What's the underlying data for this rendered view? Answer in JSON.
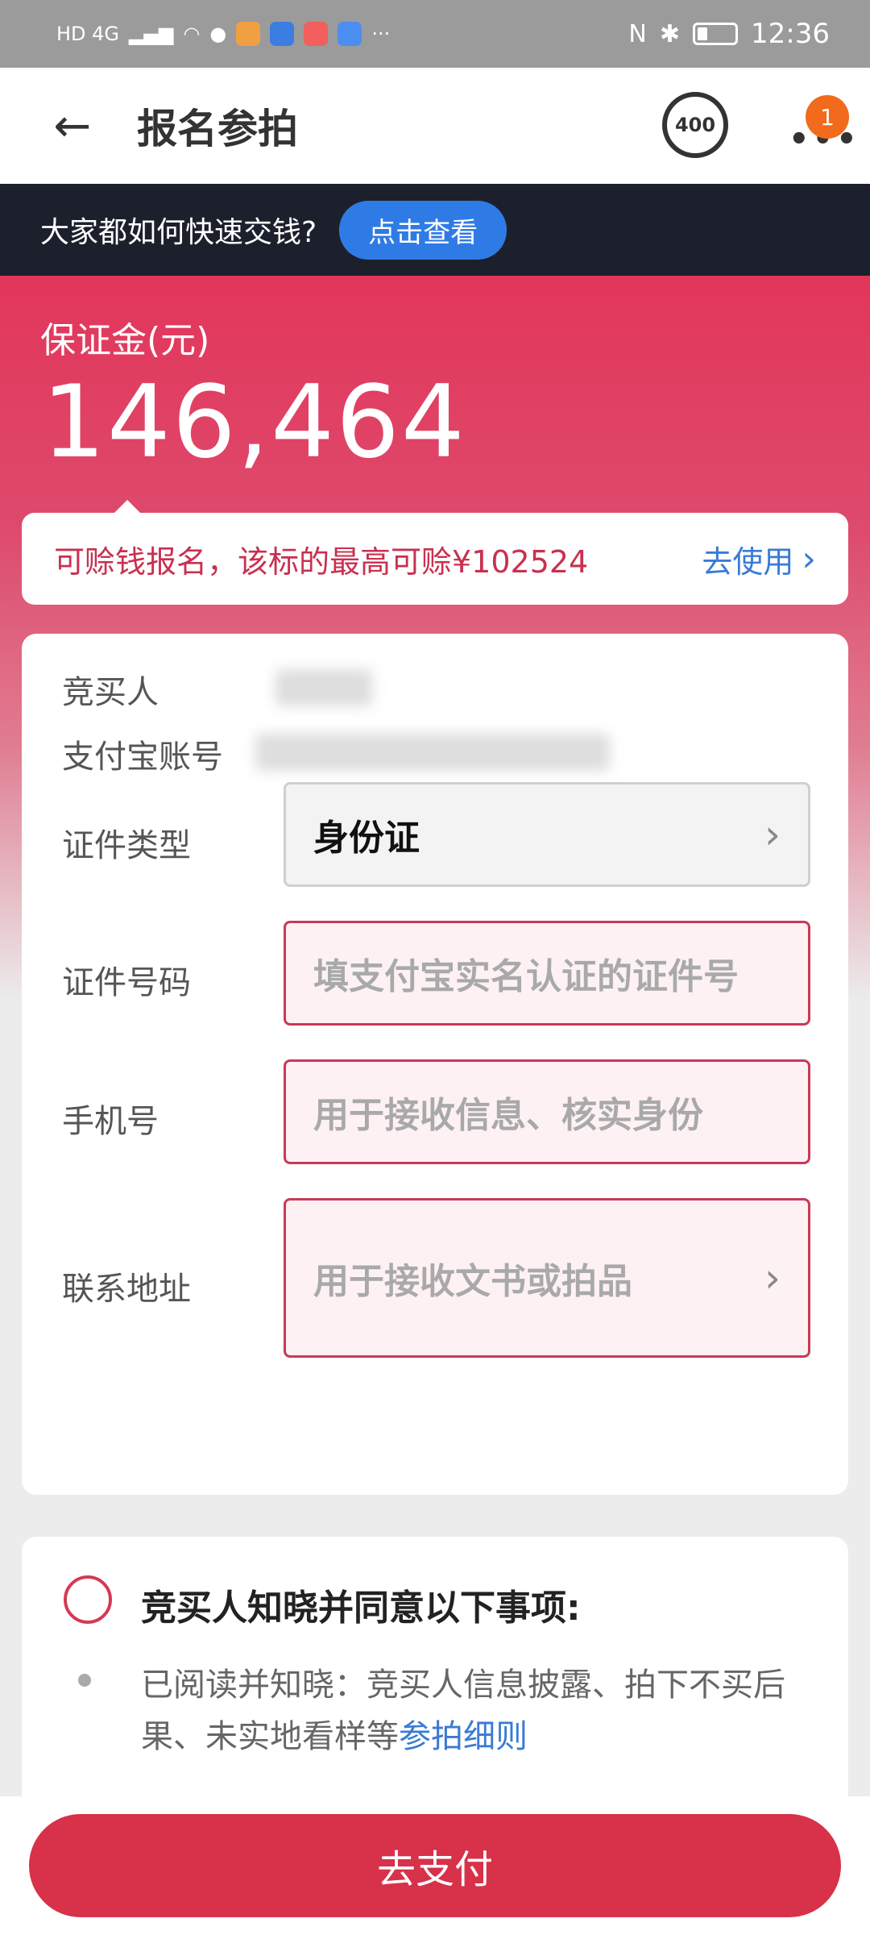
{
  "status_bar": {
    "left_text": "HD 4G",
    "time": "12:36"
  },
  "nav": {
    "title": "报名参拍",
    "hotline_label": "400",
    "badge_count": "1"
  },
  "banner": {
    "text": "大家都如何快速交钱?",
    "button": "点击查看"
  },
  "deposit": {
    "label": "保证金(元)",
    "amount": "146,464"
  },
  "coupon": {
    "text": "可赊钱报名，该标的最高可赊¥102524",
    "action": "去使用"
  },
  "form": {
    "bidder_label": "竞买人",
    "alipay_label": "支付宝账号",
    "id_type_label": "证件类型",
    "id_type_value": "身份证",
    "id_number_label": "证件号码",
    "id_number_placeholder": "填支付宝实名认证的证件号",
    "phone_label": "手机号",
    "phone_placeholder": "用于接收信息、核实身份",
    "address_label": "联系地址",
    "address_placeholder": "用于接收文书或拍品"
  },
  "agreement": {
    "title": "竞买人知晓并同意以下事项:",
    "text": "已阅读并知晓：竞买人信息披露、拍下不买后果、未实地看样等",
    "link": "参拍细则"
  },
  "pay_button": "去支付",
  "colors": {
    "brand_red": "#d8314a",
    "link_blue": "#3a7bd5",
    "banner_dark": "#1c202c"
  }
}
